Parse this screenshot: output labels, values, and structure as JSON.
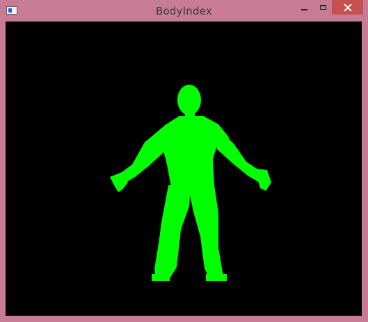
{
  "window": {
    "title": "BodyIndex",
    "frame_color": "#c87b95",
    "close_color": "#c75050"
  },
  "canvas": {
    "background": "#000000",
    "body_color": "#00ff00"
  },
  "icons": [
    "app-icon",
    "minimize-icon",
    "maximize-icon",
    "close-icon"
  ]
}
